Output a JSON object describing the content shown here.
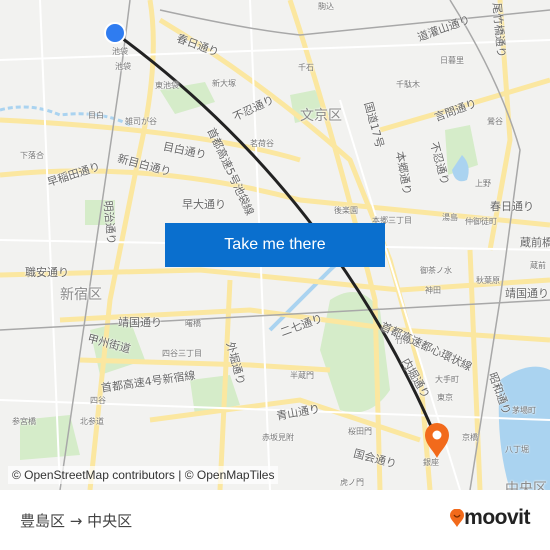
{
  "map": {
    "labels": [
      "池袋",
      "池袋",
      "東池袋",
      "新大塚",
      "千石",
      "駒込",
      "文京区",
      "不忍通り",
      "春日通り",
      "目白",
      "雑司が谷",
      "目白通り",
      "新目白通り",
      "早稲田通り",
      "下落合",
      "茗荷谷",
      "早大通り",
      "千駄木",
      "日暮里",
      "言問通り",
      "鶯谷",
      "上野",
      "春日通り",
      "湯島",
      "仲御徒町",
      "後楽園",
      "本郷三丁目",
      "本郷通り",
      "国道17号",
      "不忍通り",
      "道灌山通り",
      "尾竹橋通り",
      "新宿区",
      "職安通り",
      "明治通り",
      "靖国通り",
      "甲州街道",
      "四谷三丁目",
      "外堀通り",
      "二七通り",
      "神田",
      "秋葉原",
      "御茶ノ水",
      "竹橋",
      "大手町",
      "東京",
      "京橋",
      "銀座",
      "八丁堀",
      "茅場町",
      "桜田門",
      "国会通り",
      "虎ノ門",
      "赤坂見附",
      "青山通り",
      "半蔵門",
      "首都高速4号新宿線",
      "四谷",
      "昭和通り",
      "蔵前橋",
      "靖国通り",
      "中央区",
      "内堀通り",
      "首都高速都心環状線",
      "曙橋",
      "参宮橋",
      "北参道",
      "蔵前",
      "首都高速5号池袋線"
    ],
    "route_color": "#222222",
    "origin_marker_color": "#2f7cf0",
    "destination_marker_color": "#f26a1b"
  },
  "cta": {
    "label": "Take me there",
    "color": "#0a6fce"
  },
  "attribution": "© OpenStreetMap contributors | © OpenMapTiles",
  "footer": {
    "origin": "豊島区",
    "arrow": "→",
    "destination": "中央区",
    "brand": "moovit",
    "brand_color": "#f26a1b"
  }
}
